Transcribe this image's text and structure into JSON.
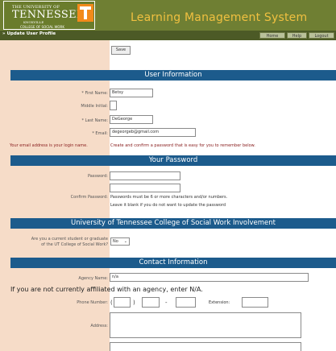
{
  "header": {
    "logo_line1": "THE UNIVERSITY OF",
    "logo_line2": "TENNESSEE",
    "logo_line3": "KNOXVILLE",
    "logo_line4": "COLLEGE OF SOCIAL WORK",
    "app_title": "Learning Management System"
  },
  "nav": {
    "breadcrumb": "» Update User Profile",
    "home": "Home",
    "help": "Help",
    "logout": "Logout"
  },
  "toolbar": {
    "save_label": "Save"
  },
  "user_info": {
    "title": "User Information",
    "first_name_label": "* First Name:",
    "first_name_value": "Betsy",
    "middle_initial_label": "Middle Initial:",
    "middle_initial_value": "",
    "last_name_label": "* Last Name:",
    "last_name_value": "DeGeorge",
    "email_label": "* Email:",
    "email_value": "degeorgeb@gmail.com",
    "login_note": "Your email address is your login name.",
    "login_note2": "Create and confirm a password that is easy for you to remember below."
  },
  "password": {
    "title": "Your Password",
    "password_label": "Password:",
    "confirm_label": "Confirm Password:",
    "rule_note": "Passwords must be 6 or more characters and/or numbers.",
    "blank_note": "Leave it blank if you do not want to update the password"
  },
  "involvement": {
    "title": "University of Tennessee College of Social Work Involvement",
    "question_line1": "Are you a current student or graduate",
    "question_line2": "of the UT College of Social Work?",
    "selected": "No"
  },
  "contact": {
    "title": "Contact Information",
    "agency_label": "Agency Name:",
    "agency_value": "n/a",
    "agency_note": "If you are not currently affiliated with an agency, enter N/A.",
    "phone_label": "Phone Number:",
    "phone_open": "(",
    "phone_close": ")",
    "phone_dash": "-",
    "extension_label": "Extension:",
    "address_label": "Address:"
  }
}
